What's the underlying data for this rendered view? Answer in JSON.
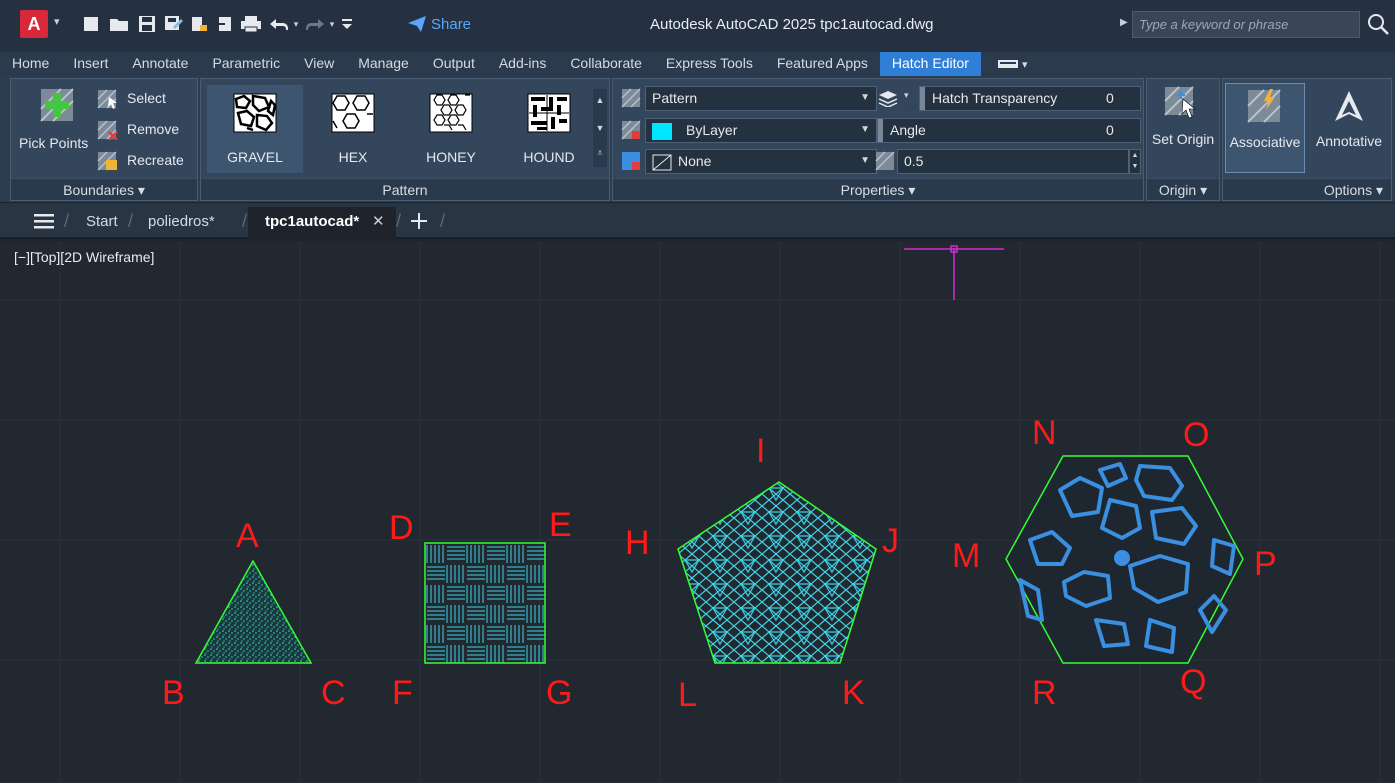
{
  "titlebar": {
    "logo_letter": "A",
    "share_label": "Share",
    "title": "Autodesk AutoCAD 2025   tpc1autocad.dwg",
    "search_placeholder": "Type a keyword or phrase"
  },
  "ribbon_tabs": [
    "Home",
    "Insert",
    "Annotate",
    "Parametric",
    "View",
    "Manage",
    "Output",
    "Add-ins",
    "Collaborate",
    "Express Tools",
    "Featured Apps",
    "Hatch Editor"
  ],
  "active_tab": "Hatch Editor",
  "boundaries": {
    "pick_points": "Pick Points",
    "select": "Select",
    "remove": "Remove",
    "recreate": "Recreate",
    "footer": "Boundaries"
  },
  "pattern": {
    "tiles": [
      "GRAVEL",
      "HEX",
      "HONEY",
      "HOUND"
    ],
    "selected": "GRAVEL",
    "footer": "Pattern"
  },
  "properties": {
    "type": "Pattern",
    "color": "ByLayer",
    "color_swatch": "#00e5ff",
    "background": "None",
    "transparency_label": "Hatch Transparency",
    "transparency_value": "0",
    "angle_label": "Angle",
    "angle_value": "0",
    "scale_value": "0.5",
    "footer": "Properties"
  },
  "origin": {
    "set_origin": "Set Origin",
    "footer": "Origin"
  },
  "options": {
    "associative": "Associative",
    "annotative": "Annotative",
    "footer": "Options"
  },
  "doc_tabs": {
    "start": "Start",
    "file1": "poliedros*",
    "file2": "tpc1autocad*"
  },
  "viewport": {
    "label": "[−][Top][2D Wireframe]",
    "vertex_labels": [
      "A",
      "B",
      "C",
      "D",
      "E",
      "F",
      "G",
      "H",
      "I",
      "J",
      "K",
      "L",
      "M",
      "N",
      "O",
      "P",
      "Q",
      "R"
    ]
  },
  "colors": {
    "label_red": "#ff1a1a",
    "shape_green": "#33ff33",
    "hatch_cyan": "#3fd3e6",
    "gravel_blue": "#3a8fe0",
    "crosshair_magenta": "#d12cd1"
  }
}
